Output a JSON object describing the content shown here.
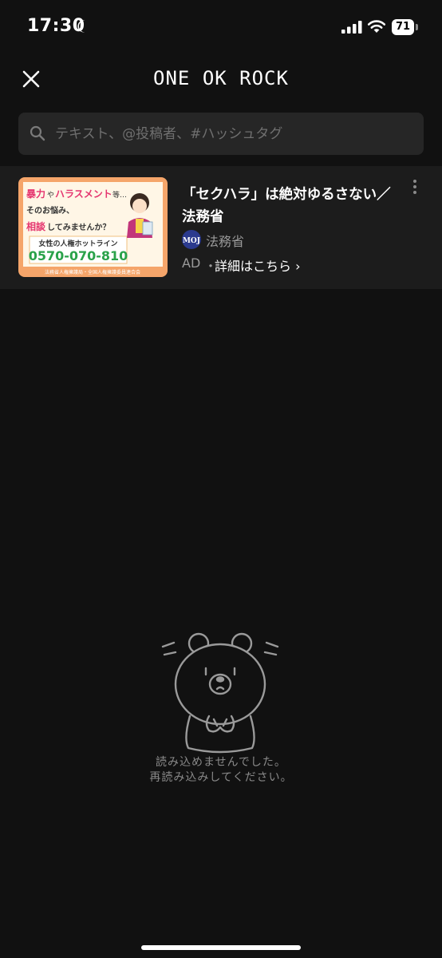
{
  "status_bar": {
    "time": "17:30",
    "battery": "71",
    "icons": [
      "moon-icon",
      "cellular-signal-icon",
      "wifi-icon",
      "battery-icon"
    ]
  },
  "header": {
    "title": "ONE OK ROCK",
    "close_icon": "close-icon"
  },
  "search": {
    "placeholder": "テキスト、@投稿者、#ハッシュタグ",
    "value": ""
  },
  "ad": {
    "title": "「セクハラ」は絶対ゆるさない／法務省",
    "advertiser": "法務省",
    "advertiser_logo_text": "MOJ",
    "label": "AD",
    "separator": "・",
    "details_link": "詳細はこちら ›",
    "image": {
      "line1_a": "暴力",
      "line1_b": "や",
      "line1_c": "ハラスメント",
      "line1_d": "等…",
      "line2": "そのお悩み、",
      "line3_a": "相談",
      "line3_b": "してみませんか？",
      "hotline_label": "女性の人権ホットライン",
      "hotline_number": "0570-070-810",
      "footer": "法務省人権擁護局・全国人権擁護委員連合会"
    }
  },
  "empty_state": {
    "line1": "読み込めませんでした。",
    "line2": "再読み込みしてください。"
  },
  "colors": {
    "background": "#111111",
    "search_bg": "#262626",
    "ad_bg": "#1c1c1c",
    "muted_text": "#9a9a9a",
    "hotline_green": "#2aa24a",
    "highlight_pink": "#e5356f",
    "ad_image_bg": "#f5a56a"
  }
}
